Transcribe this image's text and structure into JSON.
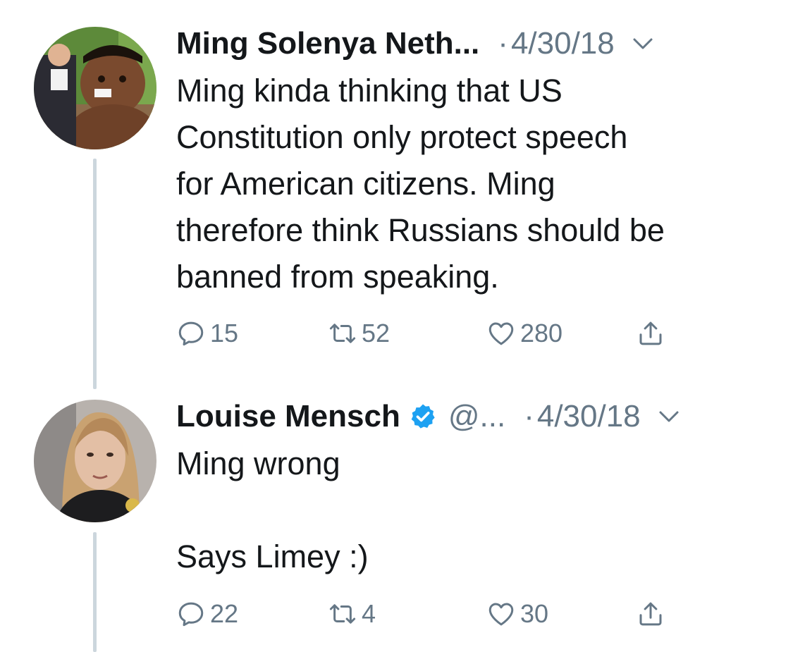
{
  "tweets": [
    {
      "name": "Ming Solenya Neth...",
      "handle": "",
      "dot": "·",
      "date": "4/30/18",
      "text": "Ming kinda thinking that US\nConstitution only protect speech\nfor American citizens. Ming\ntherefore think Russians should be\nbanned from speaking.",
      "replies": "15",
      "retweets": "52",
      "likes": "280"
    },
    {
      "name": "Louise Mensch",
      "handle": "@...",
      "dot": "·",
      "date": "4/30/18",
      "text": "Ming wrong\n\nSays Limey :)",
      "replies": "22",
      "retweets": "4",
      "likes": "30"
    }
  ],
  "icons": [
    "reply-icon",
    "retweet-icon",
    "like-icon",
    "share-icon",
    "chevron-down-icon",
    "verified-badge-icon"
  ],
  "colors": {
    "text": "#14171a",
    "secondary": "#657786",
    "verified": "#1da1f2",
    "thread_line": "#ccd6dd"
  }
}
